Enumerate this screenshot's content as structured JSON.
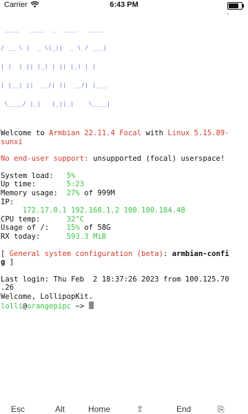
{
  "status_bar": {
    "carrier": "Carrier",
    "time": "6:43 PM",
    "battery_level": 0.85
  },
  "terminal": {
    "logo_lines": [
      " ____   ____  _  ____   ____ ",
      "/ __ \\ |  _ \\(_)|  _ \\ / ___|",
      "| |  | || |_) | || |_) | |    ",
      "| |__| ||  __/| ||  __/| |___ ",
      " \\____/ |_|   |_||_|    \\____|"
    ],
    "welcome": {
      "prefix": "Welcome to ",
      "distro": "Armbian 22.11.4 Focal",
      "middle": " with ",
      "kernel_line1": "Linux 5.15.89-",
      "kernel_line2": "sunxi"
    },
    "support": {
      "label": "No end-user support:",
      "text": " unsupported (focal) userspace!"
    },
    "sysinfo": {
      "load_label": "System load:   ",
      "load_value": "5%",
      "uptime_label": "Up time:       ",
      "uptime_value": "5:23",
      "mem_label": "Memory usage:  ",
      "mem_value": "27%",
      "mem_suffix": " of 999M",
      "ip_label": "IP:",
      "ip_value": "     172.17.0.1 192.168.1.2 100.100.184.48",
      "cpu_label": "CPU temp:      ",
      "cpu_value": "32°C",
      "usage_label": "Usage of /:    ",
      "usage_value": "15%",
      "usage_suffix": " of 58G",
      "rx_label": "RX today:      ",
      "rx_value": "593.3 MiB"
    },
    "config": {
      "open": "[ ",
      "text": "General system configuration (beta)",
      "colon": ": ",
      "cmd_line1": "armbian-confi",
      "cmd_line2": "g",
      "close": " ]"
    },
    "last_login_line1": "Last login: Thu Feb  2 18:37:26 2023 from 100.125.70",
    "last_login_line2": ".26",
    "welcome_user": "Welcome, LollipopKit.",
    "prompt": {
      "user": "lolli",
      "at": "@",
      "host": "orangepipc",
      "path": " ~> "
    }
  },
  "keyboard_bar": {
    "keys": [
      "Esc",
      "Alt",
      "Home",
      "⇧",
      "End",
      "⎘"
    ]
  }
}
